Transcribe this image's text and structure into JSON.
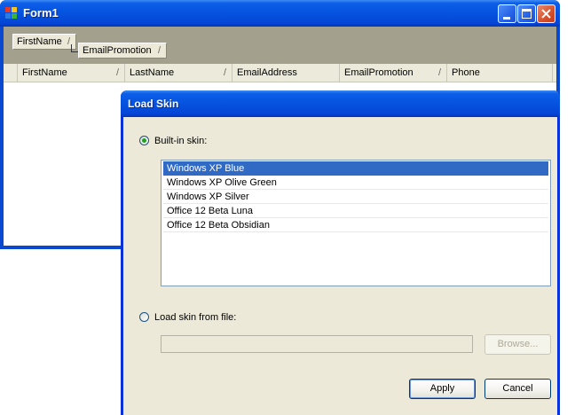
{
  "form1": {
    "title": "Form1",
    "group_by": [
      "FirstName",
      "EmailPromotion"
    ],
    "columns": [
      "FirstName",
      "LastName",
      "EmailAddress",
      "EmailPromotion",
      "Phone"
    ],
    "sort_glyph": "/"
  },
  "dialog": {
    "title": "Load Skin",
    "builtin_label": "Built-in skin:",
    "builtin_selected": true,
    "skins": [
      "Windows XP Blue",
      "Windows XP Olive Green",
      "Windows XP Silver",
      "Office 12 Beta Luna",
      "Office 12 Beta Obsidian"
    ],
    "selected_skin": "Windows XP Blue",
    "file_label": "Load skin from file:",
    "file_path": "",
    "browse_label": "Browse...",
    "apply_label": "Apply",
    "cancel_label": "Cancel"
  },
  "colors": {
    "titlebar": "#0553df",
    "selection": "#316ac5",
    "dialog_face": "#ece9d8",
    "group_panel": "#a3a08d"
  }
}
